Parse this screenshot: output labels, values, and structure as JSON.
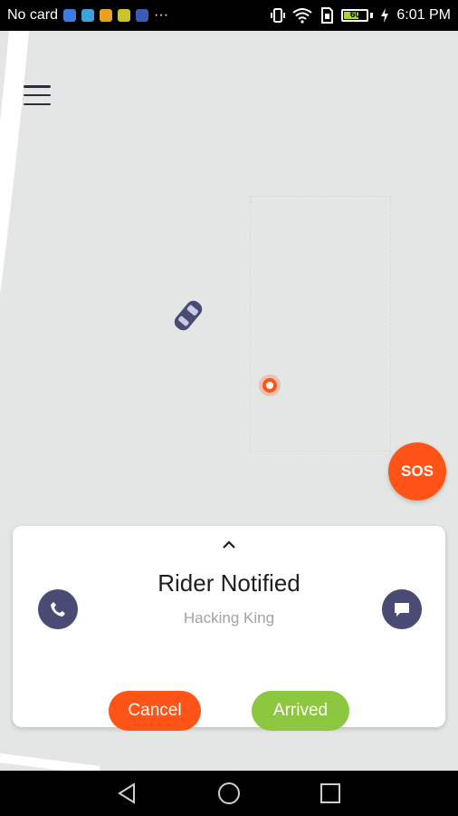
{
  "status_bar": {
    "carrier": "No card",
    "notification_icons": [
      "vpn-icon",
      "messages-icon",
      "instagram-icon",
      "maps-icon",
      "facebook-icon"
    ],
    "overflow": "···",
    "battery_level": "60",
    "time": "6:01 PM"
  },
  "map": {
    "menu_icon": "hamburger-menu-icon",
    "car_icon": "car-icon",
    "pickup_icon": "pickup-location-pin-icon"
  },
  "sos": {
    "label": "SOS"
  },
  "ride_card": {
    "expand_icon": "chevron-up-icon",
    "status_title": "Rider Notified",
    "rider_name": "Hacking King",
    "call_icon": "phone-icon",
    "chat_icon": "chat-bubble-icon",
    "cancel_label": "Cancel",
    "arrived_label": "Arrived"
  },
  "nav_bar": {
    "back_icon": "back-triangle-icon",
    "home_icon": "home-circle-icon",
    "recents_icon": "recents-square-icon"
  },
  "colors": {
    "accent_orange": "#ff5317",
    "accent_green": "#8dc63f",
    "icon_purple": "#4a4b74",
    "map_background": "#e4e6e6"
  }
}
